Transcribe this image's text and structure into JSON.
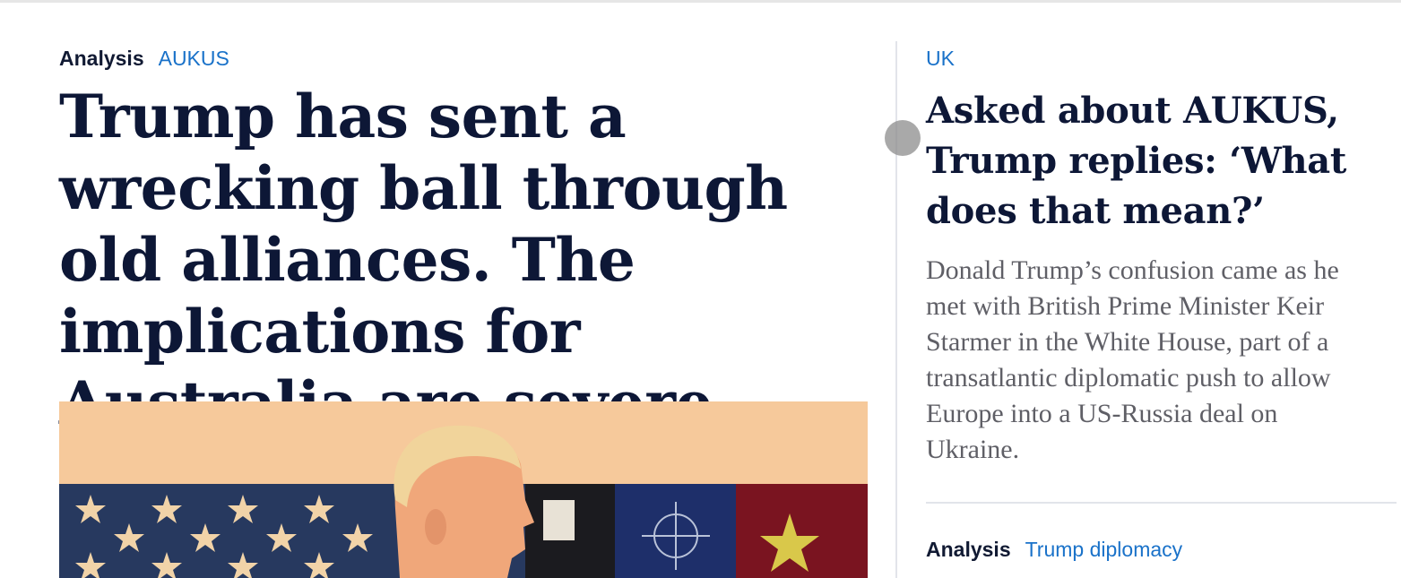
{
  "main_story": {
    "kicker_label": "Analysis",
    "kicker_topic": "AUKUS",
    "headline": "Trump has sent a wrecking ball through old alliances. The implications for Australia are severe",
    "image_alt": "Illustration of Donald Trump against US flag stars and NATO emblem"
  },
  "side_story": {
    "kicker_topic": "UK",
    "headline": "Asked about AUKUS, Trump replies: ‘What does that mean?’",
    "standfirst": "Donald Trump’s confusion came as he met with British Prime Minister Keir Starmer in the White House, part of a transatlantic diplomatic push to allow Europe into a US-Russia deal on Ukraine."
  },
  "next_story": {
    "kicker_label": "Analysis",
    "kicker_topic": "Trump diplomacy"
  },
  "colors": {
    "accent": "#1a72c9",
    "headline": "#0d1736",
    "standfirst": "#5f5f66"
  }
}
